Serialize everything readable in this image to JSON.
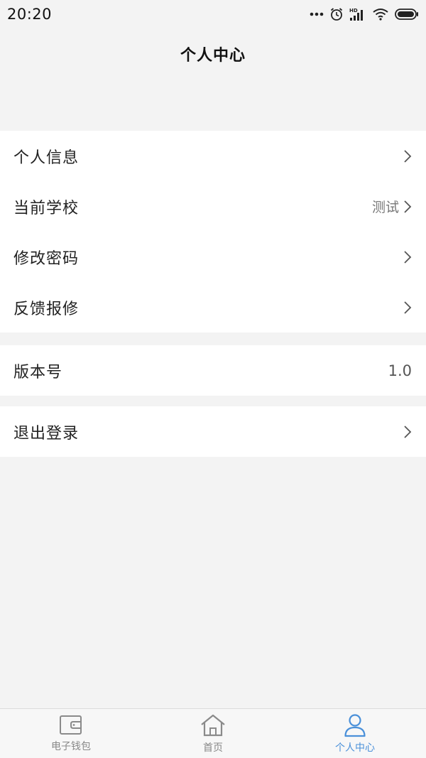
{
  "status_bar": {
    "time": "20:20",
    "signal_label": "HD"
  },
  "header": {
    "title": "个人中心"
  },
  "menu": {
    "personal_info": "个人信息",
    "current_school": "当前学校",
    "current_school_value": "测试",
    "change_password": "修改密码",
    "feedback_repair": "反馈报修",
    "version_label": "版本号",
    "version_value": "1.0",
    "logout": "退出登录"
  },
  "tabbar": {
    "wallet": "电子钱包",
    "home": "首页",
    "profile": "个人中心",
    "active": "profile"
  },
  "colors": {
    "accent": "#4a90d9",
    "background": "#f3f3f3",
    "card": "#ffffff",
    "inactive": "#888888"
  }
}
